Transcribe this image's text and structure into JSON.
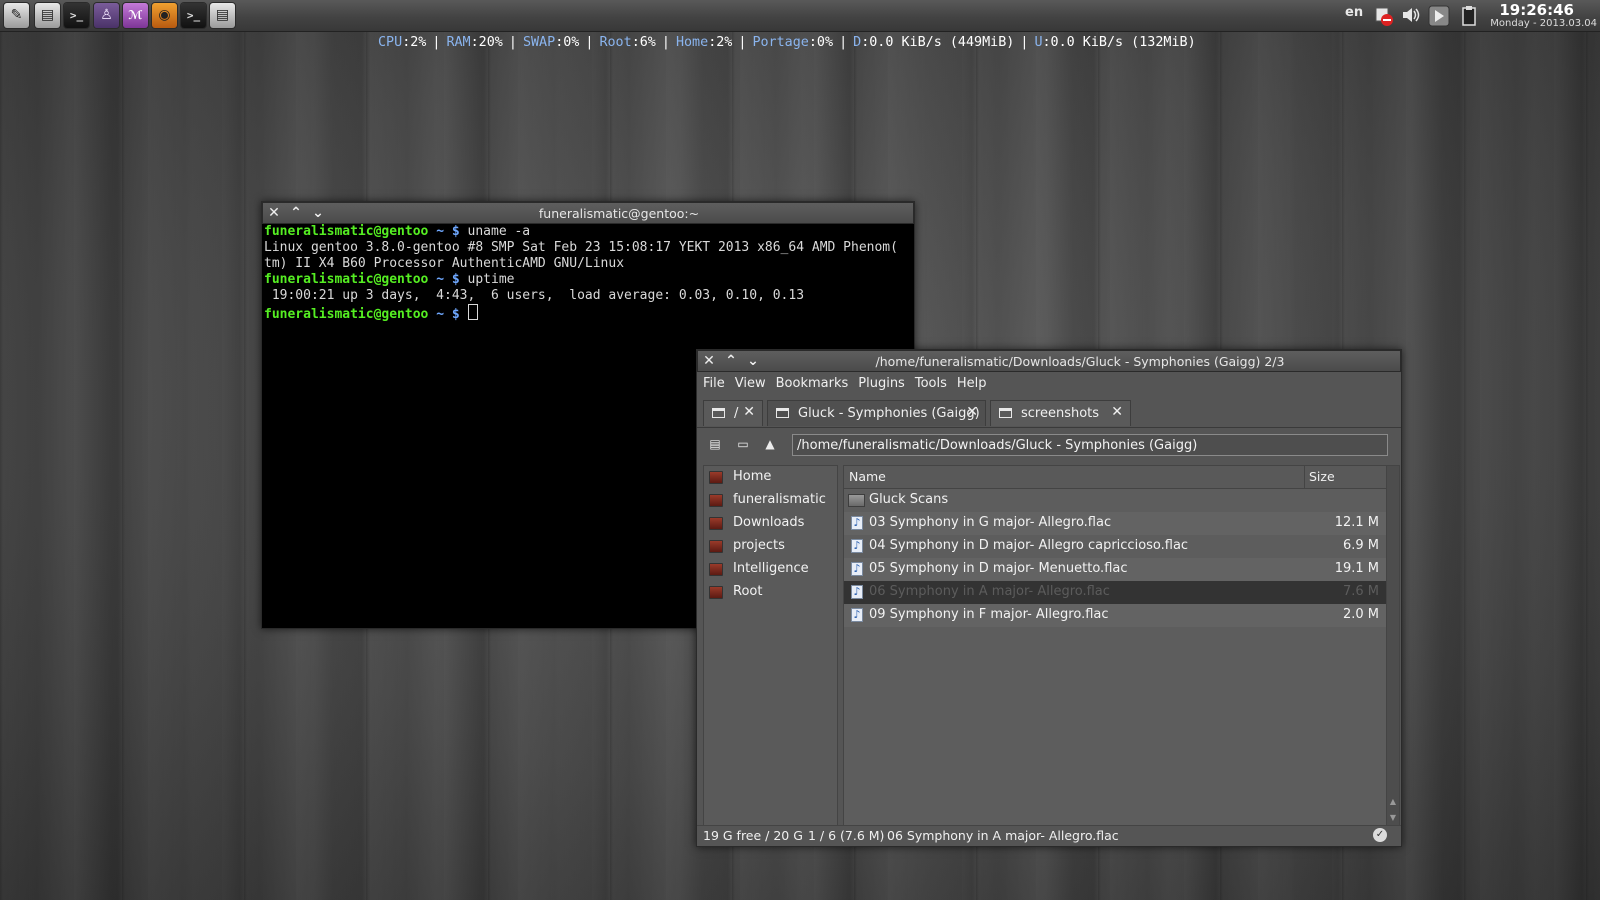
{
  "panel": {
    "launchers": [
      {
        "icon": "app-menu-icon",
        "glyph": "✎"
      },
      {
        "icon": "file-manager-icon",
        "glyph": "▤"
      },
      {
        "icon": "terminal-icon",
        "glyph": ">_"
      },
      {
        "icon": "wine-icon",
        "glyph": "♙"
      },
      {
        "icon": "emacs-icon",
        "glyph": "ℳ"
      },
      {
        "icon": "browser-icon",
        "glyph": "◉"
      },
      {
        "icon": "terminal-alt-icon",
        "glyph": ">_"
      },
      {
        "icon": "text-editor-icon",
        "glyph": "▤"
      }
    ],
    "keyboard_layout": "en",
    "clock_time": "19:26:46",
    "clock_date": "Monday - 2013.03.04"
  },
  "status_line": {
    "items": [
      {
        "label": "CPU",
        "value": ":2%"
      },
      {
        "label": "RAM",
        "value": ":20%"
      },
      {
        "label": "SWAP",
        "value": ":0%"
      },
      {
        "label": "Root",
        "value": ":6%"
      },
      {
        "label": "Home",
        "value": ":2%"
      },
      {
        "label": "Portage",
        "value": ":0%"
      },
      {
        "label": "D",
        "value": ":0.0 KiB/s (449MiB)"
      },
      {
        "label": "U",
        "value": ":0.0 KiB/s (132MiB)"
      }
    ]
  },
  "terminal": {
    "title": "funeralismatic@gentoo:~",
    "prompt_user": "funeralismatic@gentoo",
    "prompt_dir": " ~ $",
    "cmd1": " uname -a",
    "out1a": "Linux gentoo 3.8.0-gentoo #8 SMP Sat Feb 23 15:08:17 YEKT 2013 x86_64 AMD Phenom(",
    "out1b": "tm) II X4 B60 Processor AuthenticAMD GNU/Linux",
    "cmd2": " uptime",
    "out2": " 19:00:21 up 3 days,  4:43,  6 users,  load average: 0.03, 0.10, 0.13"
  },
  "file_manager": {
    "title": "/home/funeralismatic/Downloads/Gluck - Symphonies (Gaigg) 2/3",
    "menu": [
      "File",
      "View",
      "Bookmarks",
      "Plugins",
      "Tools",
      "Help"
    ],
    "tabs": [
      {
        "label": "/"
      },
      {
        "label": "Gluck - Symphonies (Gaigg)"
      },
      {
        "label": "screenshots"
      }
    ],
    "path": "/home/funeralismatic/Downloads/Gluck - Symphonies (Gaigg)",
    "places": [
      "Home",
      "funeralismatic",
      "Downloads",
      "projects",
      "Intelligence",
      "Root"
    ],
    "columns": {
      "name": "Name",
      "size": "Size"
    },
    "files": [
      {
        "name": "Gluck Scans",
        "size": "",
        "type": "folder"
      },
      {
        "name": "03 Symphony in G major- Allegro.flac",
        "size": "12.1 M",
        "type": "audio"
      },
      {
        "name": "04 Symphony in D major- Allegro capriccioso.flac",
        "size": "6.9 M",
        "type": "audio"
      },
      {
        "name": "05 Symphony in D major- Menuetto.flac",
        "size": "19.1 M",
        "type": "audio"
      },
      {
        "name": "06 Symphony in A major- Allegro.flac",
        "size": "7.6 M",
        "type": "audio"
      },
      {
        "name": "09 Symphony in F major- Allegro.flac",
        "size": "2.0 M",
        "type": "audio"
      }
    ],
    "status": {
      "free": "19 G free / 20 G",
      "selection": "1 / 6 (7.6 M)",
      "selected_file": "06 Symphony in A major- Allegro.flac"
    }
  }
}
